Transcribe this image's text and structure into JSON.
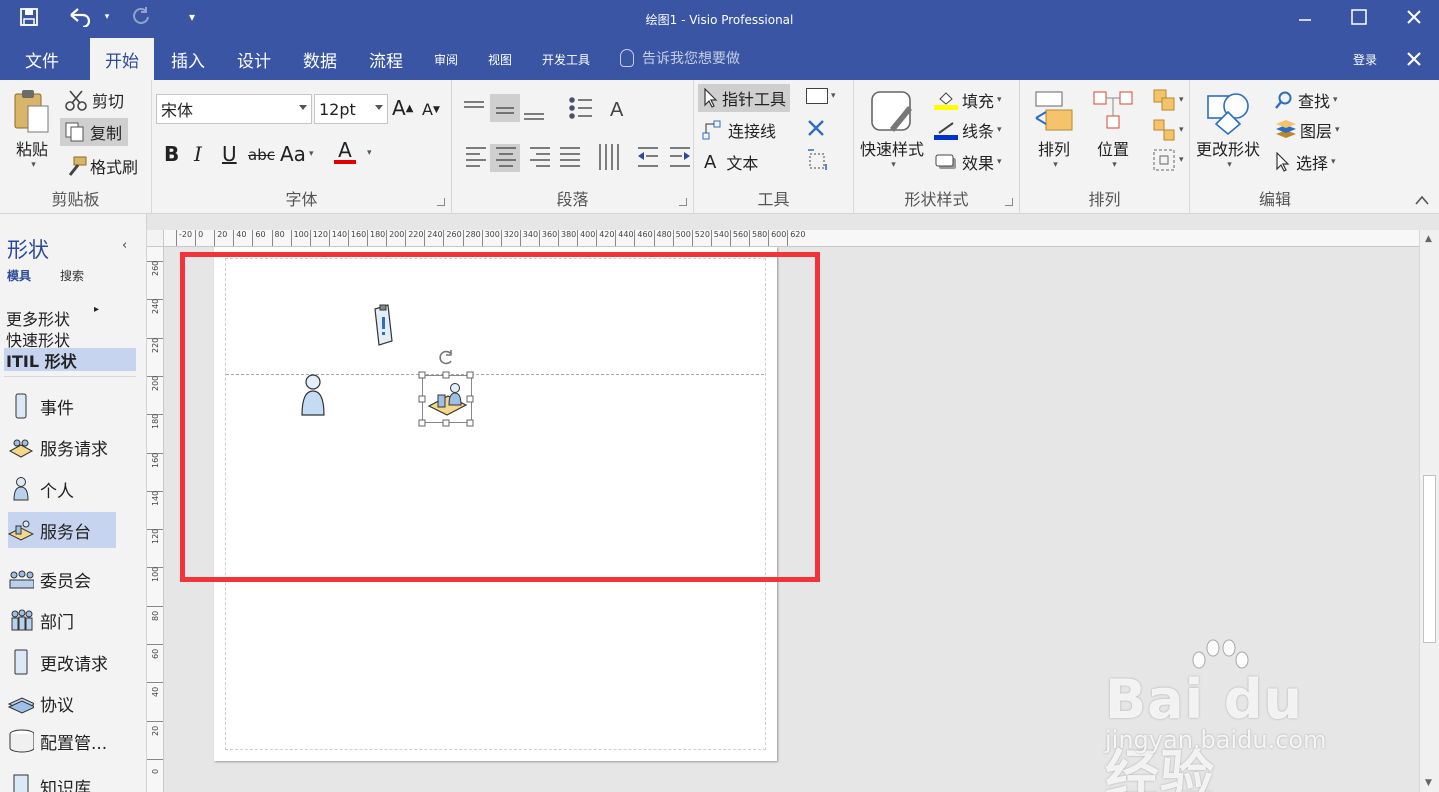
{
  "window": {
    "title": "绘图1 - Visio Professional"
  },
  "tabs": [
    {
      "label": "文件"
    },
    {
      "label": "开始"
    },
    {
      "label": "插入"
    },
    {
      "label": "设计"
    },
    {
      "label": "数据"
    },
    {
      "label": "流程"
    },
    {
      "label": "审阅"
    },
    {
      "label": "视图"
    },
    {
      "label": "开发工具"
    }
  ],
  "tell_me": "告诉我您想要做",
  "signin": "登录",
  "ribbon": {
    "clipboard": {
      "paste": "粘贴",
      "cut": "剪切",
      "copy": "复制",
      "format_painter": "格式刷",
      "label": "剪贴板"
    },
    "font": {
      "name": "宋体",
      "size": "12pt",
      "label": "字体",
      "bold": "B",
      "italic": "I",
      "underline": "U",
      "strike": "abc",
      "case": "Aa",
      "color_letter": "A"
    },
    "paragraph": {
      "label": "段落"
    },
    "tools": {
      "pointer": "指针工具",
      "connector": "连接线",
      "text": "文本",
      "label": "工具"
    },
    "shape_styles": {
      "quick_styles": "快速样式",
      "fill": "填充",
      "line": "线条",
      "effects": "效果",
      "label": "形状样式"
    },
    "arrange": {
      "arrange": "排列",
      "position": "位置",
      "label": "排列"
    },
    "editing": {
      "change_shape": "更改形状",
      "find": "查找",
      "layers": "图层",
      "select": "选择",
      "label": "编辑"
    }
  },
  "shapes_pane": {
    "title": "形状",
    "tab_stencils": "模具",
    "tab_search": "搜索",
    "more_shapes": "更多形状",
    "quick_shapes": "快速形状",
    "active_stencil": "ITIL 形状",
    "items": [
      {
        "label": "事件"
      },
      {
        "label": "服务请求"
      },
      {
        "label": "个人"
      },
      {
        "label": "服务台"
      },
      {
        "label": "委员会"
      },
      {
        "label": "部门"
      },
      {
        "label": "更改请求"
      },
      {
        "label": "协议"
      },
      {
        "label": "配置管..."
      },
      {
        "label": "知识库"
      }
    ]
  },
  "rulers": {
    "h_labels": [
      "-20",
      "0",
      "20",
      "40",
      "60",
      "80",
      "100",
      "120",
      "140",
      "160",
      "180",
      "200",
      "220",
      "240",
      "260",
      "280",
      "300",
      "320",
      "340",
      "360",
      "380",
      "400",
      "420",
      "440",
      "460",
      "480",
      "500",
      "520",
      "540",
      "560",
      "580",
      "600",
      "620"
    ],
    "v_labels": [
      "260",
      "240",
      "220",
      "200",
      "180",
      "160",
      "140",
      "120",
      "100",
      "80",
      "60",
      "40",
      "20",
      "0"
    ]
  },
  "watermark": {
    "brand": "Bai du 经验",
    "url": "jingyan.baidu.com"
  },
  "colors": {
    "title_bar": "#3955a3",
    "highlight": "#f2333a",
    "selection": "#c7d4ef"
  }
}
